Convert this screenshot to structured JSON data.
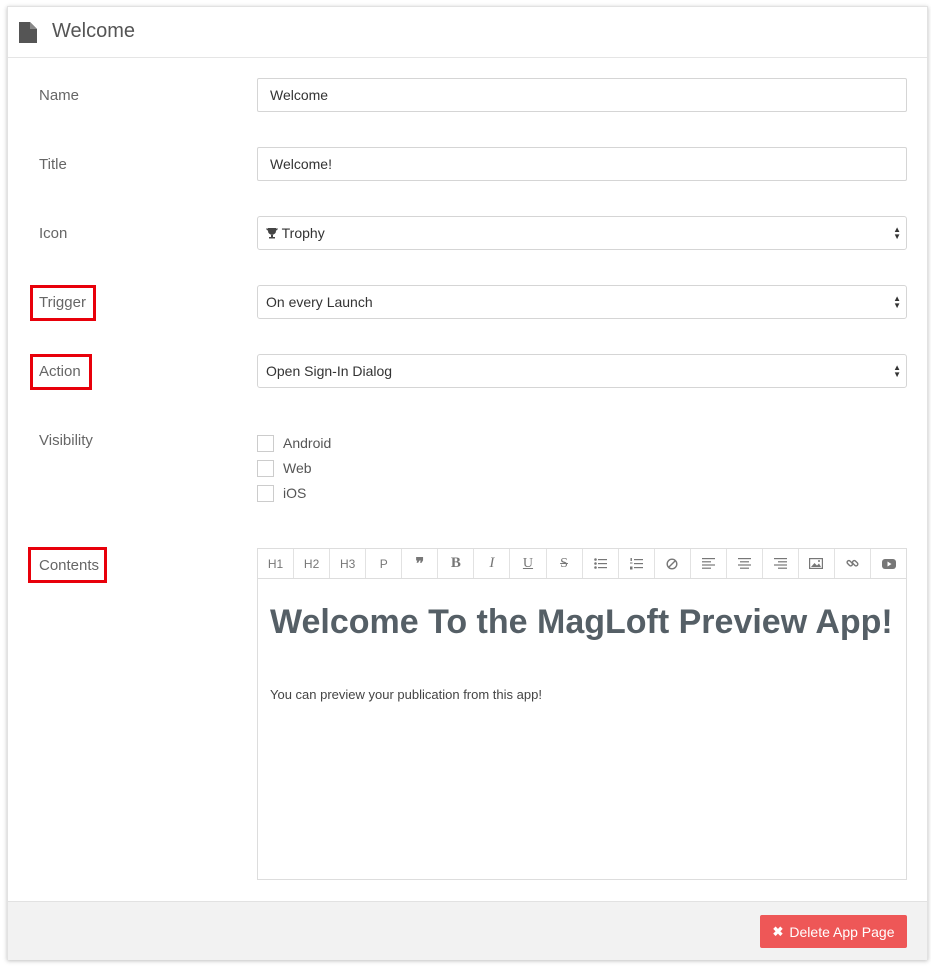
{
  "header": {
    "title": "Welcome",
    "icon": "document-icon"
  },
  "form": {
    "name": {
      "label": "Name",
      "value": "Welcome"
    },
    "title": {
      "label": "Title",
      "value": "Welcome!"
    },
    "icon": {
      "label": "Icon",
      "value": "Trophy",
      "value_icon": "trophy-icon"
    },
    "trigger": {
      "label": "Trigger",
      "value": "On every Launch"
    },
    "action": {
      "label": "Action",
      "value": "Open Sign-In Dialog"
    },
    "visibility": {
      "label": "Visibility",
      "options": [
        {
          "label": "Android",
          "checked": false
        },
        {
          "label": "Web",
          "checked": false
        },
        {
          "label": "iOS",
          "checked": false
        }
      ]
    },
    "contents": {
      "label": "Contents",
      "toolbar": [
        "H1",
        "H2",
        "H3",
        "P"
      ],
      "toolbar_icons": [
        "quote-icon",
        "bold-icon",
        "italic-icon",
        "underline-icon",
        "strikethrough-icon",
        "bullet-list-icon",
        "numbered-list-icon",
        "clear-format-icon",
        "align-left-icon",
        "align-center-icon",
        "align-right-icon",
        "image-icon",
        "link-icon",
        "video-icon"
      ],
      "heading": "Welcome To the MagLoft Preview App!",
      "paragraph": "You can preview your publication from this app!"
    }
  },
  "footer": {
    "delete_label": "Delete App Page"
  },
  "colors": {
    "highlight": "#e8000a",
    "danger": "#ee5757"
  }
}
